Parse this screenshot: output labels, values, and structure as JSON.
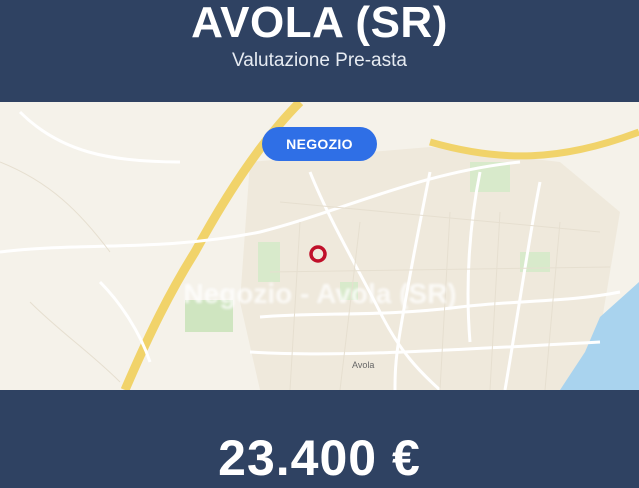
{
  "header": {
    "title": "AVOLA (SR)",
    "subtitle": "Valutazione Pre-asta"
  },
  "map": {
    "badge": "NEGOZIO",
    "watermark": "Negozio - Avola (SR)",
    "town_label": "Avola",
    "marker_icon": "location-ring-icon",
    "colors": {
      "background": "#f5f2ea",
      "highway": "#f1d36a",
      "sea": "#a9d3ee",
      "green": "#cfe5c0",
      "marker": "#c0102a"
    }
  },
  "footer": {
    "price": "23.400 €"
  },
  "colors": {
    "panel": "#2f4262",
    "badge": "#2f6fe6"
  }
}
